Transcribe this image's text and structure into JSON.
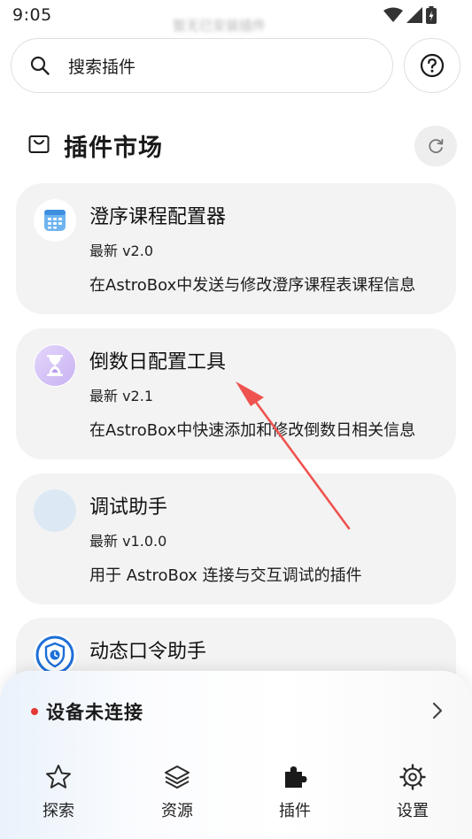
{
  "status_bar": {
    "time": "9:05",
    "hint": "暂无已安装插件"
  },
  "search": {
    "placeholder": "搜索插件"
  },
  "section": {
    "title": "插件市场"
  },
  "plugins": [
    {
      "name": "澄序课程配置器",
      "version": "最新 v2.0",
      "description": "在AstroBox中发送与修改澄序课程表课程信息",
      "icon": "calendar-grid-icon"
    },
    {
      "name": "倒数日配置工具",
      "version": "最新 v2.1",
      "description": "在AstroBox中快速添加和修改倒数日相关信息",
      "icon": "hourglass-icon"
    },
    {
      "name": "调试助手",
      "version": "最新 v1.0.0",
      "description": "用于 AstroBox 连接与交互调试的插件",
      "icon": "blank-circle-icon"
    },
    {
      "name": "动态口令助手",
      "version": "",
      "description": "",
      "icon": "shield-clock-icon"
    }
  ],
  "device": {
    "status": "设备未连接",
    "dot_color": "#e53935"
  },
  "nav": {
    "items": [
      {
        "label": "探索",
        "icon": "star-icon"
      },
      {
        "label": "资源",
        "icon": "layers-icon"
      },
      {
        "label": "插件",
        "icon": "puzzle-icon"
      },
      {
        "label": "设置",
        "icon": "gear-icon"
      }
    ]
  },
  "colors": {
    "card_background": "#f3f3f3",
    "annotation_arrow": "#ef5350",
    "accent_blue": "#1e6fd9"
  }
}
